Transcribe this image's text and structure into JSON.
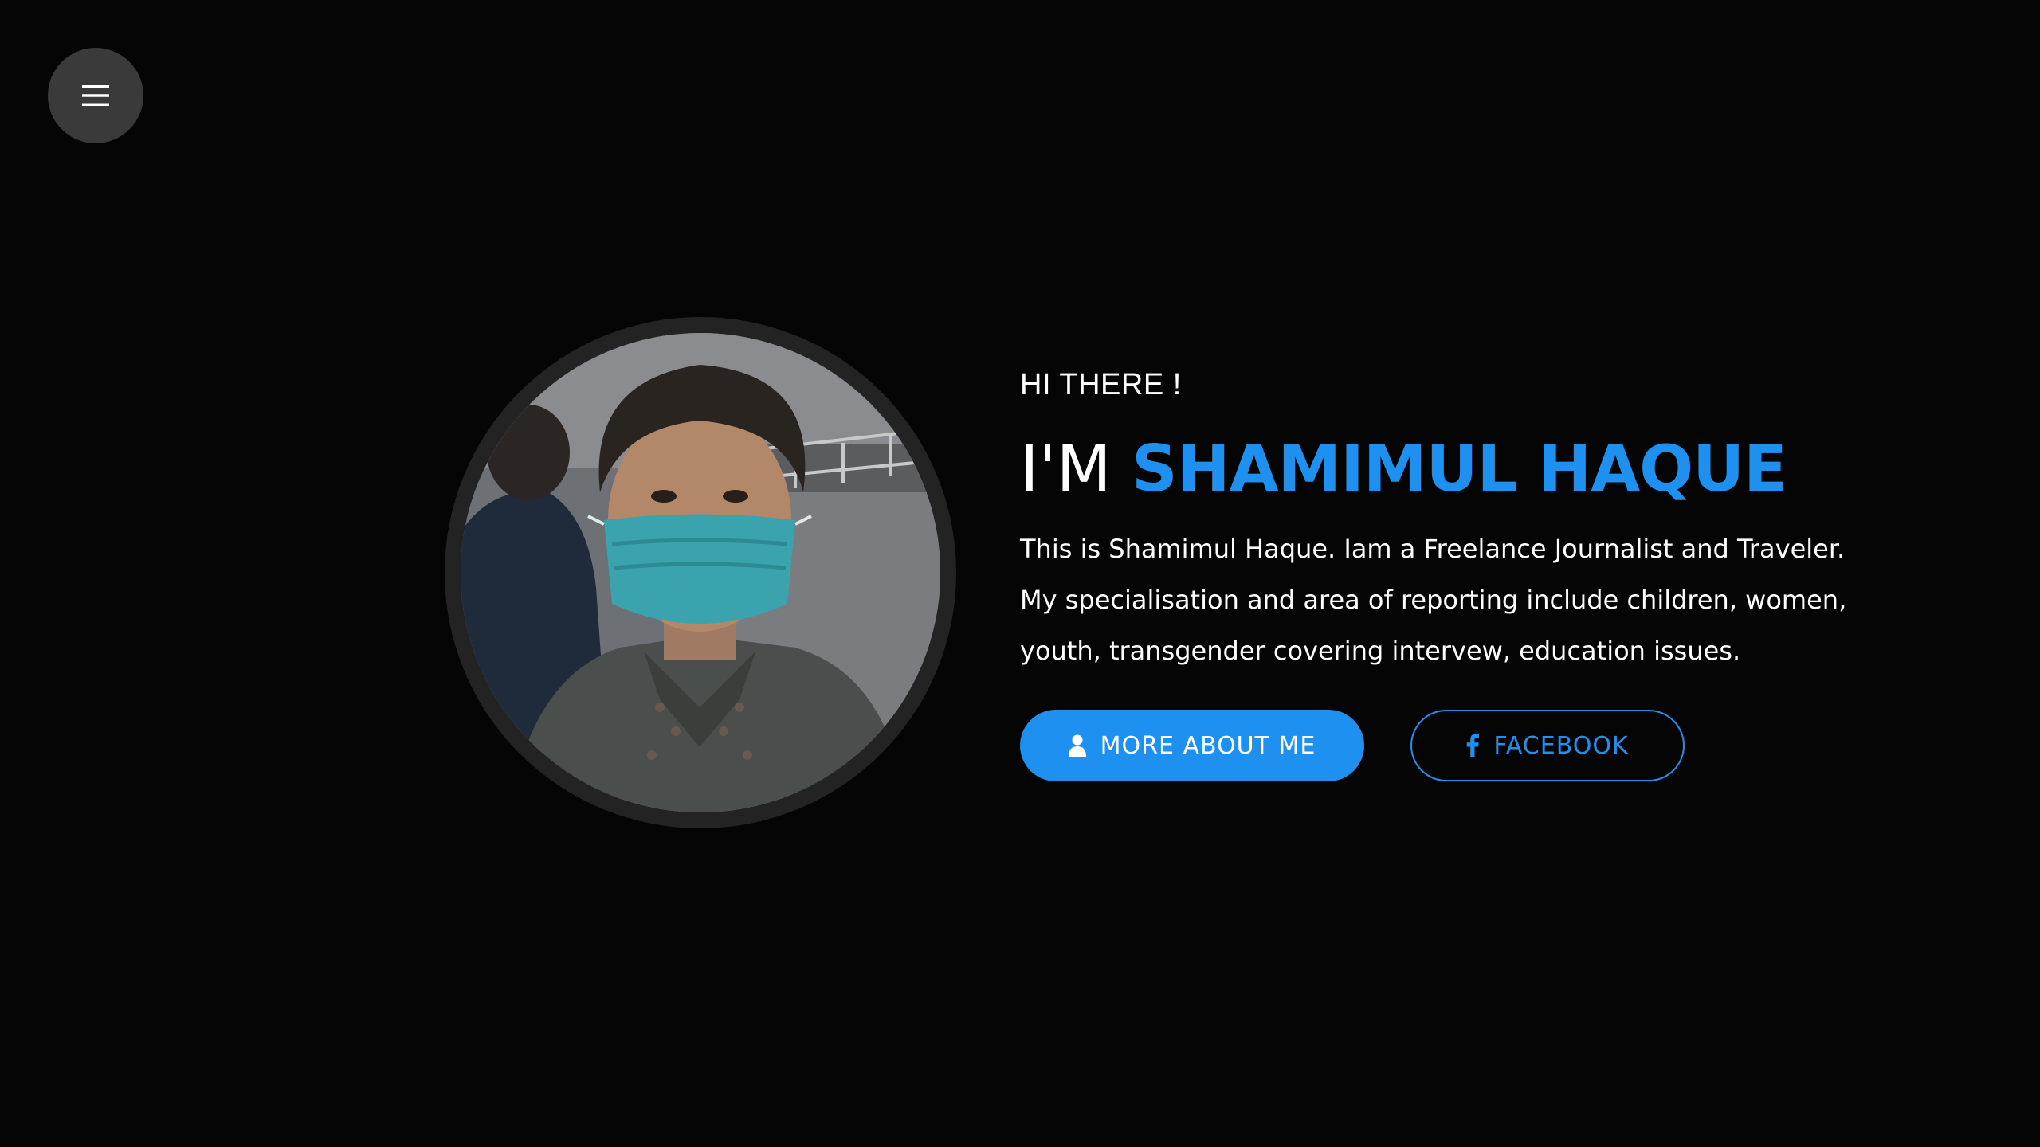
{
  "menu": {
    "icon": "hamburger-menu-icon"
  },
  "profile": {
    "photo_alt": "Photo of Shamimul Haque wearing a surgical mask"
  },
  "intro": {
    "greeting": "HI THERE !",
    "headline_prefix": "I'M",
    "name": "SHAMIMUL HAQUE",
    "bio": "This is Shamimul Haque. Iam a Freelance Journalist and Traveler. My specialisation and area of reporting include children, women, youth, transgender covering intervew, education issues."
  },
  "buttons": {
    "about": {
      "label": "MORE ABOUT ME",
      "icon": "user-icon"
    },
    "facebook": {
      "label": "FACEBOOK",
      "icon": "facebook-icon"
    }
  },
  "colors": {
    "background": "#050505",
    "accent": "#1e90f0",
    "menu_button": "#3a3a3a",
    "avatar_ring": "#232323"
  }
}
